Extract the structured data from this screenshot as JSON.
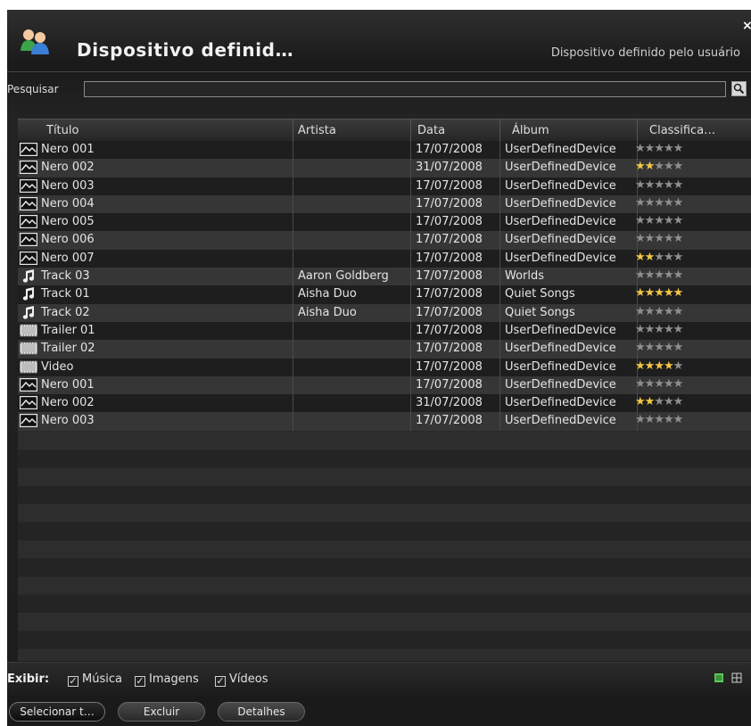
{
  "header": {
    "title": "Dispositivo definid…",
    "subtitle": "Dispositivo definido pelo usuário",
    "close_label": "×"
  },
  "search": {
    "label": "Pesquisar",
    "value": "",
    "placeholder": ""
  },
  "columns": [
    "Título",
    "Artista",
    "Data",
    "Álbum",
    "Classifica…"
  ],
  "rows": [
    {
      "type": "image",
      "title": "Nero 001",
      "artist": "",
      "date": "17/07/2008",
      "album": "UserDefinedDevice",
      "rating": 0
    },
    {
      "type": "image",
      "title": "Nero 002",
      "artist": "",
      "date": "31/07/2008",
      "album": "UserDefinedDevice",
      "rating": 2
    },
    {
      "type": "image",
      "title": "Nero 003",
      "artist": "",
      "date": "17/07/2008",
      "album": "UserDefinedDevice",
      "rating": 0
    },
    {
      "type": "image",
      "title": "Nero 004",
      "artist": "",
      "date": "17/07/2008",
      "album": "UserDefinedDevice",
      "rating": 0
    },
    {
      "type": "image",
      "title": "Nero 005",
      "artist": "",
      "date": "17/07/2008",
      "album": "UserDefinedDevice",
      "rating": 0
    },
    {
      "type": "image",
      "title": "Nero 006",
      "artist": "",
      "date": "17/07/2008",
      "album": "UserDefinedDevice",
      "rating": 0
    },
    {
      "type": "image",
      "title": "Nero 007",
      "artist": "",
      "date": "17/07/2008",
      "album": "UserDefinedDevice",
      "rating": 2
    },
    {
      "type": "music",
      "title": "Track 03",
      "artist": "Aaron Goldberg",
      "date": "17/07/2008",
      "album": "Worlds",
      "rating": 0
    },
    {
      "type": "music",
      "title": "Track 01",
      "artist": "Aisha Duo",
      "date": "17/07/2008",
      "album": "Quiet Songs",
      "rating": 5
    },
    {
      "type": "music",
      "title": "Track 02",
      "artist": "Aisha Duo",
      "date": "17/07/2008",
      "album": "Quiet Songs",
      "rating": 0
    },
    {
      "type": "video",
      "title": "Trailer 01",
      "artist": "",
      "date": "17/07/2008",
      "album": "UserDefinedDevice",
      "rating": 0
    },
    {
      "type": "video",
      "title": "Trailer 02",
      "artist": "",
      "date": "17/07/2008",
      "album": "UserDefinedDevice",
      "rating": 0
    },
    {
      "type": "video",
      "title": "Video",
      "artist": "",
      "date": "17/07/2008",
      "album": "UserDefinedDevice",
      "rating": 4
    },
    {
      "type": "image",
      "title": "Nero 001",
      "artist": "",
      "date": "17/07/2008",
      "album": "UserDefinedDevice",
      "rating": 0
    },
    {
      "type": "image",
      "title": "Nero 002",
      "artist": "",
      "date": "31/07/2008",
      "album": "UserDefinedDevice",
      "rating": 2
    },
    {
      "type": "image",
      "title": "Nero 003",
      "artist": "",
      "date": "17/07/2008",
      "album": "UserDefinedDevice",
      "rating": 0
    }
  ],
  "filter": {
    "label": "Exibir:",
    "options": [
      {
        "label": "Música",
        "checked": true
      },
      {
        "label": "Imagens",
        "checked": true
      },
      {
        "label": "Vídeos",
        "checked": true
      }
    ]
  },
  "actions": {
    "select_all": "Selecionar t…",
    "delete": "Excluir",
    "details": "Detalhes"
  },
  "colors": {
    "star_on": "#f2c744",
    "star_off": "#8f8f8f",
    "list_view_active": "#5cc95c"
  }
}
